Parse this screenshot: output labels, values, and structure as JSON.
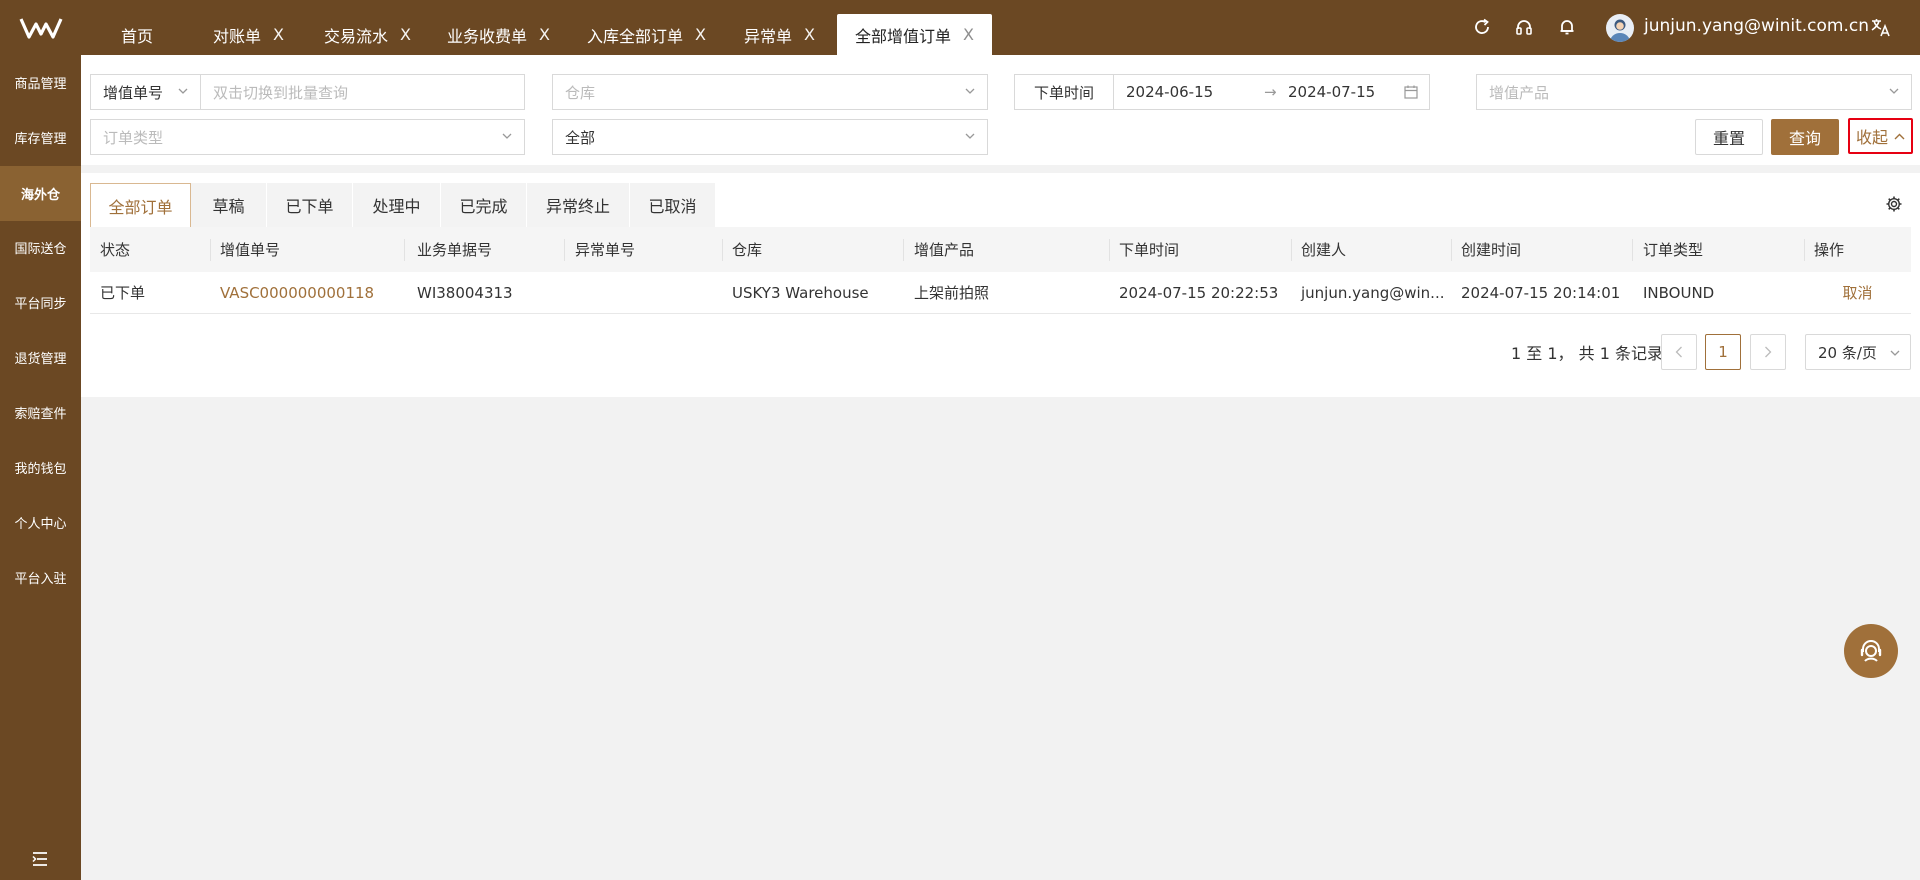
{
  "topbar": {
    "tabs": [
      {
        "label": "首页",
        "closable": false
      },
      {
        "label": "对账单",
        "closable": true
      },
      {
        "label": "交易流水",
        "closable": true
      },
      {
        "label": "业务收费单",
        "closable": true
      },
      {
        "label": "入库全部订单",
        "closable": true
      },
      {
        "label": "异常单",
        "closable": true
      },
      {
        "label": "全部增值订单",
        "closable": true,
        "active": true
      }
    ],
    "close_glyph": "X",
    "user_email": "junjun.yang@winit.com.cn",
    "icons": [
      "refresh-icon",
      "headset-icon",
      "bell-icon",
      "translate-icon"
    ]
  },
  "sidebar": {
    "items": [
      {
        "label": "商品管理"
      },
      {
        "label": "库存管理"
      },
      {
        "label": "海外仓",
        "active": true
      },
      {
        "label": "国际送仓"
      },
      {
        "label": "平台同步"
      },
      {
        "label": "退货管理"
      },
      {
        "label": "索赔查件"
      },
      {
        "label": "我的钱包"
      },
      {
        "label": "个人中心"
      },
      {
        "label": "平台入驻"
      }
    ]
  },
  "filters": {
    "vas_number_select": "增值单号",
    "vas_number_placeholder": "双击切换到批量查询",
    "warehouse_placeholder": "仓库",
    "order_time_label": "下单时间",
    "date_start": "2024-06-15",
    "date_end": "2024-07-15",
    "vas_product_placeholder": "增值产品",
    "order_type_placeholder": "订单类型",
    "status_value": "全部",
    "reset_label": "重置",
    "search_label": "查询",
    "collapse_label": "收起"
  },
  "status_tabs": [
    "全部订单",
    "草稿",
    "已下单",
    "处理中",
    "已完成",
    "异常终止",
    "已取消"
  ],
  "table": {
    "columns": [
      "状态",
      "增值单号",
      "业务单据号",
      "异常单号",
      "仓库",
      "增值产品",
      "下单时间",
      "创建人",
      "创建时间",
      "订单类型",
      "操作"
    ],
    "rows": [
      {
        "status": "已下单",
        "vas_no": "VASC000000000118",
        "biz_no": "WI38004313",
        "exception_no": "",
        "warehouse": "USKY3 Warehouse",
        "product": "上架前拍照",
        "order_time": "2024-07-15 20:22:53",
        "creator": "junjun.yang@win...",
        "created_at": "2024-07-15 20:14:01",
        "order_type": "INBOUND",
        "action": "取消"
      }
    ]
  },
  "pagination": {
    "summary": "1 至 1， 共 1 条记录",
    "current_page": "1",
    "page_size": "20 条/页"
  },
  "colors": {
    "brand_brown": "#6b4823",
    "accent": "#a0703a",
    "highlight_red": "#e60012"
  }
}
